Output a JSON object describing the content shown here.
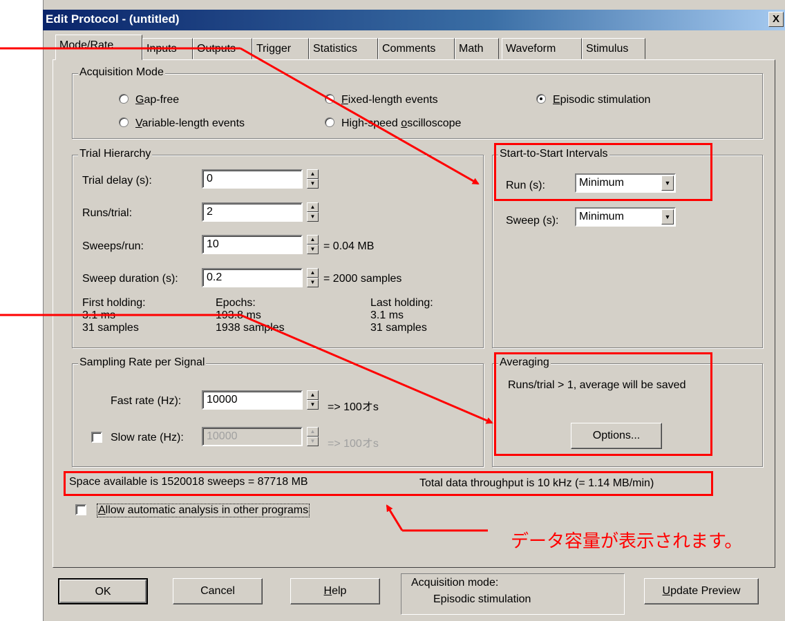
{
  "window": {
    "title": "Edit Protocol - (untitled)",
    "close_glyph": "X"
  },
  "tabs": [
    {
      "label": "Mode/Rate",
      "active": true
    },
    {
      "label": "Inputs"
    },
    {
      "label": "Outputs"
    },
    {
      "label": "Trigger"
    },
    {
      "label": "Statistics"
    },
    {
      "label": "Comments"
    },
    {
      "label": "Math"
    },
    {
      "label": "Waveform"
    },
    {
      "label": "Stimulus"
    }
  ],
  "acquisition_mode": {
    "legend": "Acquisition Mode",
    "options": {
      "gap_free": {
        "u": "G",
        "rest": "ap-free"
      },
      "variable_length": {
        "u": "V",
        "rest": "ariable-length events"
      },
      "fixed_length": {
        "u": "F",
        "rest": "ixed-length events"
      },
      "high_speed": {
        "pre": "High-speed ",
        "u": "o",
        "rest": "scilloscope"
      },
      "episodic": {
        "u": "E",
        "rest": "pisodic stimulation"
      }
    },
    "selected": "episodic"
  },
  "trial_hierarchy": {
    "legend": "Trial Hierarchy",
    "trial_delay": {
      "label": "Trial delay (s):",
      "value": "0"
    },
    "runs_trial": {
      "label": "Runs/trial:",
      "value": "2"
    },
    "sweeps_run": {
      "label": "Sweeps/run:",
      "value": "10",
      "note": "= 0.04 MB"
    },
    "sweep_duration": {
      "label": "Sweep duration (s):",
      "value": "0.2",
      "note": "= 2000 samples"
    },
    "first_holding": {
      "title": "First holding:",
      "ms": "3.1 ms",
      "samples": "31 samples"
    },
    "epochs": {
      "title": "Epochs:",
      "ms": "193.8 ms",
      "samples": "1938 samples"
    },
    "last_holding": {
      "title": "Last holding:",
      "ms": "3.1 ms",
      "samples": "31 samples"
    }
  },
  "start_to_start": {
    "legend": "Start-to-Start Intervals",
    "run": {
      "label": "Run (s):",
      "value": "Minimum"
    },
    "sweep": {
      "label": "Sweep (s):",
      "value": "Minimum"
    }
  },
  "sampling": {
    "legend": "Sampling Rate per Signal",
    "fast": {
      "label": "Fast rate  (Hz):",
      "value": "10000",
      "note": "=> 100オs"
    },
    "slow": {
      "label": "Slow rate (Hz):",
      "value": "10000",
      "note": "=> 100オs",
      "checked": false
    }
  },
  "averaging": {
    "legend": "Averaging",
    "message": "Runs/trial > 1, average will be saved",
    "options_button": "Options..."
  },
  "summary": {
    "space": "Space available is 1520018 sweeps = 87718 MB",
    "throughput": "Total data throughput is 10 kHz (= 1.14 MB/min)"
  },
  "auto_analysis": {
    "u": "A",
    "rest": "llow automatic analysis in other programs",
    "checked": false
  },
  "buttons": {
    "ok": "OK",
    "cancel": "Cancel",
    "help_u": "H",
    "help_rest": "elp",
    "update_u": "U",
    "update_rest": "pdate Preview"
  },
  "status": {
    "title": "Acquisition mode:",
    "value": "Episodic stimulation"
  },
  "annotation": {
    "text": "データ容量が表示されます。",
    "color": "#ff0000"
  },
  "colors": {
    "dialog_bg": "#d4d0c8",
    "title_start": "#0a246a",
    "title_end": "#a6caf0",
    "annotation": "#ff0000"
  }
}
